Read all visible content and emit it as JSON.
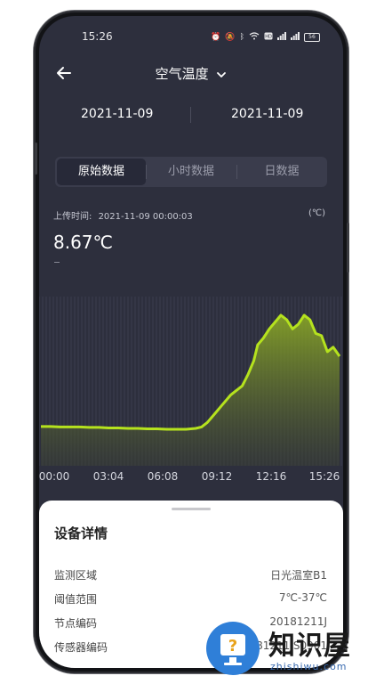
{
  "status_bar": {
    "time": "15:26",
    "battery": "56",
    "icons": [
      "alarm-icon",
      "mute-icon",
      "bluetooth-icon",
      "wifi-icon",
      "hd-icon",
      "signal-icon",
      "signal-icon",
      "battery-icon"
    ]
  },
  "header": {
    "title": "空气温度"
  },
  "date_range": {
    "start": "2021-11-09",
    "end": "2021-11-09"
  },
  "tabs": [
    {
      "label": "原始数据",
      "active": true
    },
    {
      "label": "小时数据",
      "active": false
    },
    {
      "label": "日数据",
      "active": false
    }
  ],
  "reading": {
    "upload_label": "上传时间:",
    "upload_time": "2021-11-09 00:00:03",
    "unit": "(℃)",
    "value": "8.67℃"
  },
  "colors": {
    "screen_bg": "#2d2f3d",
    "line": "#b5e21e",
    "sheet_bg": "#ffffff",
    "accent_blue": "#2f7fd8"
  },
  "chart_data": {
    "type": "area",
    "x_ticks": [
      "00:00",
      "03:04",
      "06:08",
      "09:12",
      "12:16",
      "15:26"
    ],
    "x": [
      0,
      0.5,
      1,
      1.5,
      2,
      2.5,
      3,
      3.5,
      4,
      4.5,
      5,
      5.5,
      6,
      6.5,
      7,
      7.5,
      8,
      8.3,
      8.6,
      9,
      9.4,
      9.8,
      10.1,
      10.4,
      10.7,
      11,
      11.2,
      11.5,
      11.8,
      12.1,
      12.4,
      12.7,
      13,
      13.3,
      13.6,
      13.9,
      14.2,
      14.5,
      14.8,
      15.1,
      15.43
    ],
    "values": [
      8.6,
      8.6,
      8.5,
      8.5,
      8.5,
      8.4,
      8.4,
      8.3,
      8.3,
      8.2,
      8.2,
      8.1,
      8.1,
      8.0,
      8.0,
      8.0,
      8.2,
      8.5,
      9.5,
      11.5,
      13.5,
      15.5,
      16.5,
      17.5,
      20,
      23,
      26.5,
      28,
      30,
      31.5,
      33,
      32,
      30,
      31,
      33,
      32,
      29,
      28.5,
      25,
      26,
      24
    ],
    "series_color": "#b5e21e",
    "grid": true,
    "ylim": [
      0,
      40
    ],
    "xlim": [
      0,
      15.43
    ]
  },
  "device_details": {
    "title": "设备详情",
    "rows": [
      {
        "label": "监测区域",
        "value": "日光温室B1"
      },
      {
        "label": "阈值范围",
        "value": "7℃-37℃"
      },
      {
        "label": "节点编码",
        "value": "20181211J"
      },
      {
        "label": "传感器编码",
        "value": "181211JS0901"
      }
    ]
  },
  "watermark": {
    "text": "知识屋",
    "url": "zhishiwu.com",
    "icon_symbol": "?"
  }
}
